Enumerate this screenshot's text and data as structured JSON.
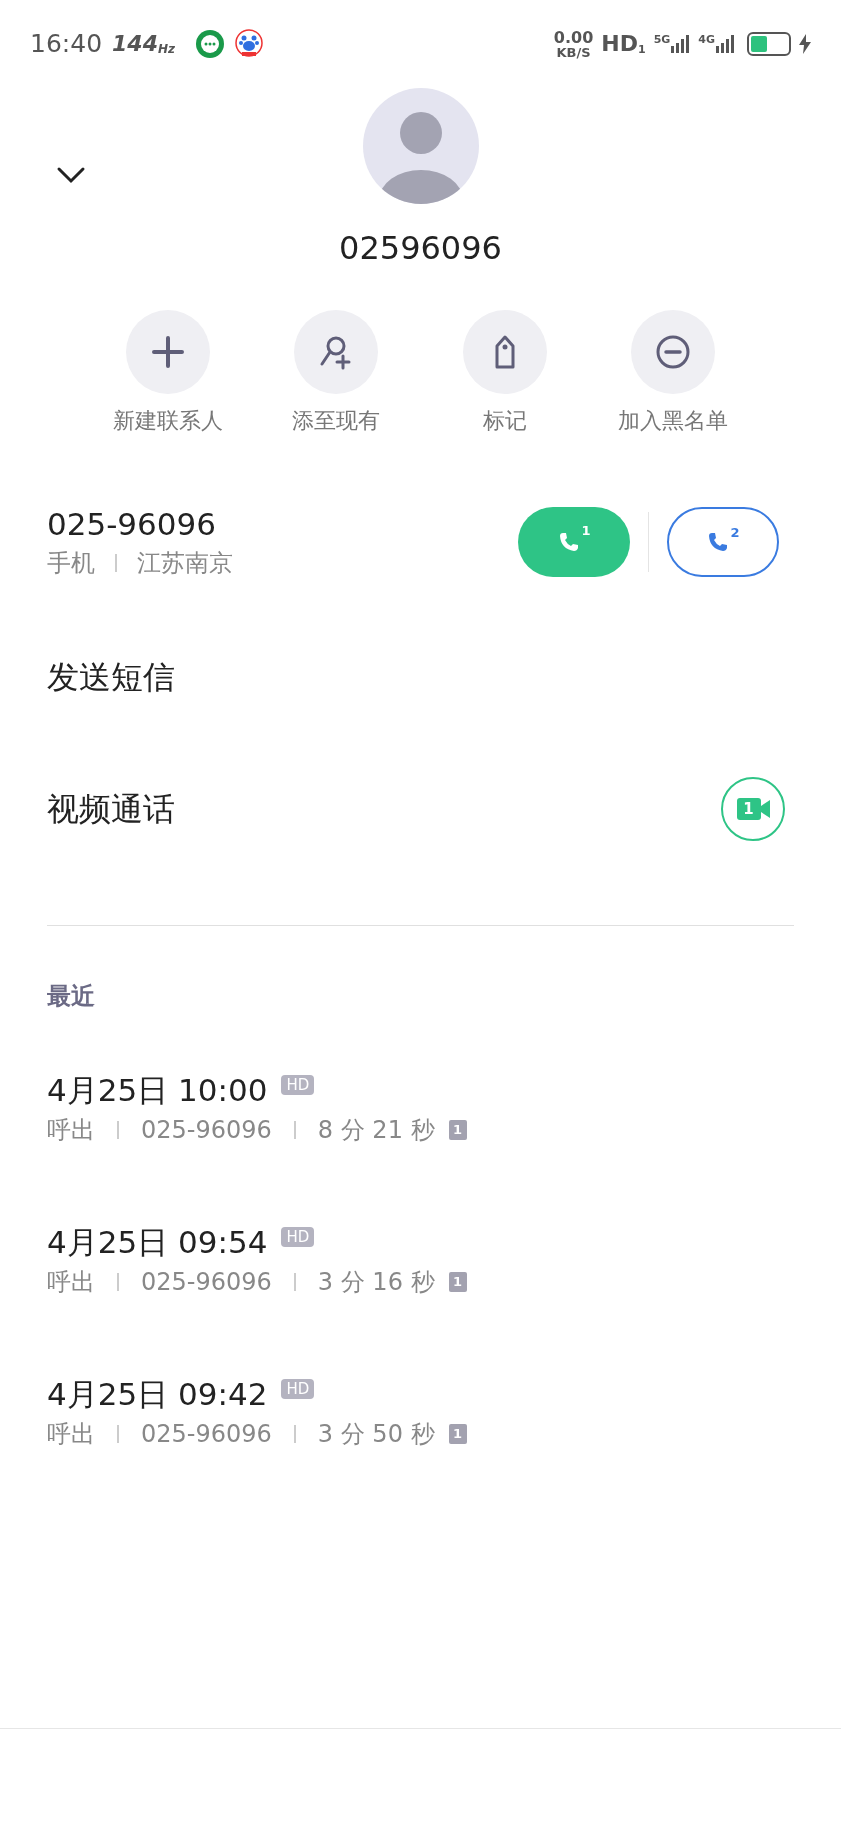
{
  "status_bar": {
    "time": "16:40",
    "refresh_rate": "144",
    "refresh_unit": "Hz",
    "net_speed": "0.00",
    "net_unit": "KB/S",
    "volte": "HD",
    "volte_sim": "1",
    "sim1_network": "5G",
    "sim2_network": "4G",
    "battery": {
      "level": 0.45
    },
    "charging": true
  },
  "contact": {
    "name": "02596096"
  },
  "actions": [
    {
      "kind": "add",
      "label": "新建联系人"
    },
    {
      "kind": "add-person",
      "label": "添至现有"
    },
    {
      "kind": "tag",
      "label": "标记"
    },
    {
      "kind": "block",
      "label": "加入黑名单"
    }
  ],
  "number": {
    "value": "025-96096",
    "type": "手机",
    "location": "江苏南京"
  },
  "call_buttons": [
    {
      "kind": "filled",
      "sim": "1"
    },
    {
      "kind": "outline",
      "sim": "2"
    }
  ],
  "options": [
    {
      "kind": "message",
      "label": "发送短信"
    },
    {
      "kind": "video",
      "label": "视频通话",
      "sim": "1"
    }
  ],
  "recent": {
    "title": "最近",
    "items": [
      {
        "datetime": "4月25日 10:00",
        "badge": "HD",
        "direction": "呼出",
        "number": "025-96096",
        "duration": "8 分 21 秒",
        "sim": "1"
      },
      {
        "datetime": "4月25日 09:54",
        "badge": "HD",
        "direction": "呼出",
        "number": "025-96096",
        "duration": "3 分 16 秒",
        "sim": "1"
      },
      {
        "datetime": "4月25日 09:42",
        "badge": "HD",
        "direction": "呼出",
        "number": "025-96096",
        "duration": "3 分 50 秒",
        "sim": "1"
      }
    ]
  }
}
